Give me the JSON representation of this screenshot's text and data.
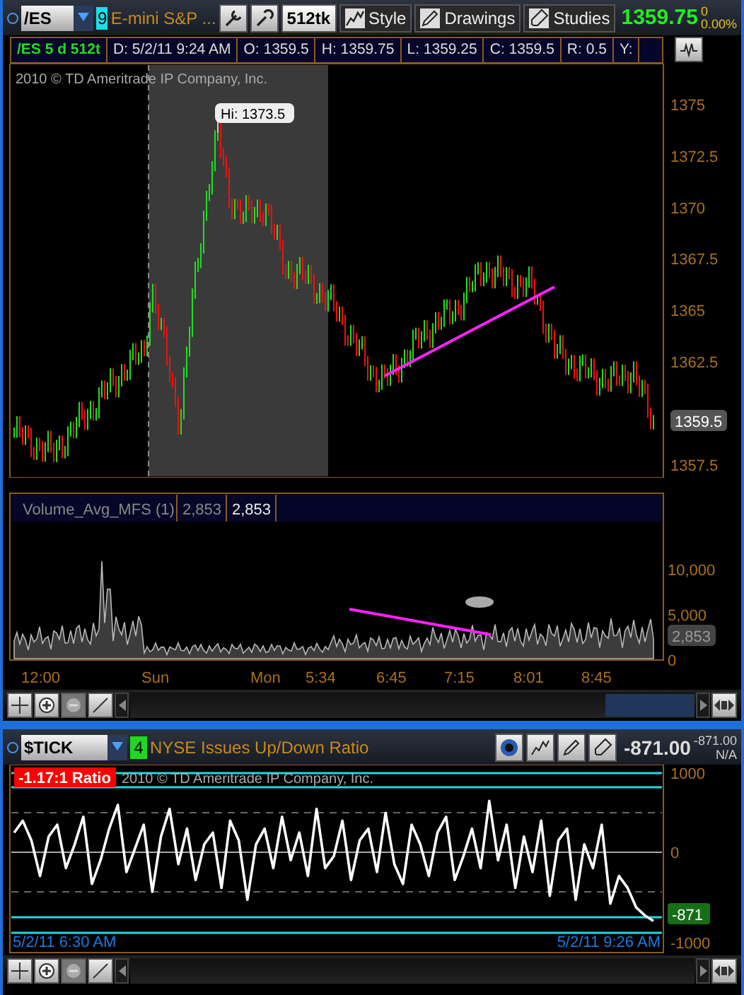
{
  "symbol_bar": {
    "symbol": "/ES",
    "grid_number": "9",
    "description": "E-mini S&P ...",
    "aggregation": "512tk",
    "buttons": [
      {
        "kind": "style",
        "label": "Style"
      },
      {
        "kind": "drawings",
        "label": "Drawings"
      },
      {
        "kind": "studies",
        "label": "Studies"
      }
    ],
    "last_price": "1359.75",
    "net_change": "0",
    "percent_change": "0.00%"
  },
  "quote_header": {
    "symbol_cell": "/ES 5 d 512t",
    "cells": [
      "D: 5/2/11 9:24 AM",
      "O: 1359.5",
      "H: 1359.75",
      "L: 1359.25",
      "C: 1359.5",
      "R: 0.5",
      "Y:"
    ]
  },
  "price_chart": {
    "copyright": "2010 © TD Ameritrade IP Company, Inc.",
    "high_label": "Hi: 1373.5",
    "axis_labels": [
      "1375",
      "1372.5",
      "1370",
      "1367.5",
      "1365",
      "1362.5",
      "1357.5"
    ],
    "price_marker": "1359.5"
  },
  "volume_study": {
    "name": "Volume_Avg_MFS (1)",
    "values": [
      "2,853",
      "2,853"
    ],
    "axis_labels": [
      "10,000",
      "5,000",
      "0"
    ],
    "value_marker": "2,853"
  },
  "time_axis": [
    "12:00",
    "Sun",
    "Mon",
    "5:34",
    "6:45",
    "7:15",
    "8:01",
    "8:45"
  ],
  "nav_tools": [
    {
      "kind": "crosshair",
      "disabled": false
    },
    {
      "kind": "zoom_in",
      "disabled": false
    },
    {
      "kind": "zoom_out",
      "disabled": true
    },
    {
      "kind": "line",
      "disabled": false
    }
  ],
  "tick_panel": {
    "symbol": "$TICK",
    "grid_number": "4",
    "description": "NYSE Issues Up/Down Ratio",
    "last": "-871.00",
    "small_last": "-871.00",
    "small_status": "N/A",
    "ratio_badge": "-1.17:1 Ratio",
    "copyright": "2010 © TD Ameritrade IP Company, Inc.",
    "chart_data": {
      "type": "line",
      "ylim": [
        -1270,
        1110
      ],
      "yticks": [
        {
          "value": 1000,
          "label": "1000"
        },
        {
          "value": 0,
          "label": "0"
        },
        {
          "value": -1000,
          "label": "-1000"
        }
      ],
      "series": [
        {
          "color": "#ffffff",
          "values": [
            250,
            400,
            150,
            -300,
            200,
            350,
            -200,
            100,
            450,
            -400,
            -100,
            300,
            600,
            -250,
            50,
            350,
            -500,
            200,
            550,
            -150,
            300,
            -350,
            100,
            250,
            -450,
            400,
            150,
            -600,
            100,
            300,
            -200,
            450,
            -100,
            250,
            -300,
            550,
            -200,
            -50,
            400,
            -350,
            150,
            300,
            -250,
            500,
            -150,
            -400,
            350,
            100,
            -300,
            250,
            450,
            -350,
            -50,
            300,
            -200,
            650,
            -100,
            350,
            -450,
            200,
            -250,
            400,
            -550,
            150,
            300,
            -600,
            100,
            -200,
            350,
            -650,
            -300,
            -450,
            -700,
            -800,
            -870
          ]
        }
      ]
    },
    "value_marker": "-871",
    "start_time": "5/2/11 6:30 AM",
    "end_time": "5/2/11 9:26 AM"
  },
  "tick_nav_tools": [
    {
      "kind": "crosshair",
      "disabled": false
    },
    {
      "kind": "zoom_in",
      "disabled": false
    },
    {
      "kind": "zoom_out",
      "disabled": true
    },
    {
      "kind": "line",
      "disabled": false
    }
  ]
}
